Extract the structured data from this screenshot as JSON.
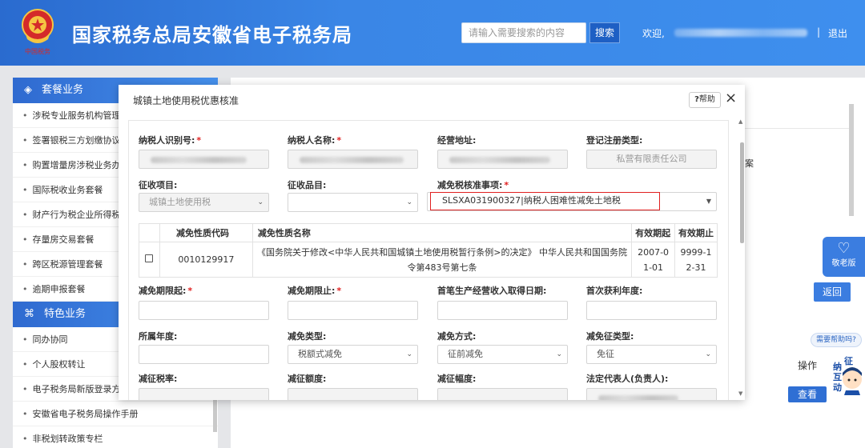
{
  "header": {
    "site_title": "国家税务总局安徽省电子税务局",
    "search_placeholder": "请输入需要搜索的内容",
    "search_button": "搜索",
    "welcome": "欢迎,",
    "separator": "|",
    "logout": "退出"
  },
  "sidebar": {
    "section1_title": "套餐业务",
    "section1_items": [
      "涉税专业服务机构管理",
      "签署银税三方划缴协议",
      "购置增量房涉税业务办",
      "国际税收业务套餐",
      "财产行为税企业所得税",
      "存量房交易套餐",
      "跨区税源管理套餐",
      "逾期申报套餐"
    ],
    "section2_title": "特色业务",
    "section2_items": [
      "同办协同",
      "个人股权转让",
      "电子税务局新版登录方",
      "安徽省电子税务局操作手册",
      "非税划转政策专栏"
    ]
  },
  "modal": {
    "title": "城镇土地使用税优惠核准",
    "help_label": "帮助",
    "close": "×",
    "fields": {
      "taxpayer_id_label": "纳税人识别号:",
      "taxpayer_name_label": "纳税人名称:",
      "address_label": "经营地址:",
      "reg_type_label": "登记注册类型:",
      "reg_type_value": "私营有限责任公司",
      "levy_item_label": "征收项目:",
      "levy_item_value": "城镇土地使用税",
      "levy_product_label": "征收品目:",
      "levy_product_value": "",
      "exempt_item_label": "减免税核准事项:",
      "exempt_item_value": "SLSXA031900327|纳税人困难性减免土地税",
      "period_start_label": "减免期限起:",
      "period_end_label": "减免期限止:",
      "first_income_date_label": "首笔生产经营收入取得日期:",
      "first_profit_year_label": "首次获利年度:",
      "belong_year_label": "所属年度:",
      "exempt_type_label": "减免类型:",
      "exempt_type_value": "税额式减免",
      "exempt_method_label": "减免方式:",
      "exempt_method_value": "征前减免",
      "exempt_levy_type_label": "减免征类型:",
      "exempt_levy_type_value": "免征",
      "levy_rate_label": "减征税率:",
      "levy_amount_label": "减征额度:",
      "levy_range_label": "减征幅度:",
      "legal_rep_label": "法定代表人(负责人):"
    },
    "table": {
      "headers": [
        "",
        "减免性质代码",
        "减免性质名称",
        "有效期起",
        "有效期止"
      ],
      "rows": [
        {
          "code": "0010129917",
          "name": "《国务院关于修改<中华人民共和国城镇土地使用税暂行条例>的决定》 中华人民共和国国务院令第483号第七条",
          "start": "2007-01-01",
          "end": "9999-12-31"
        }
      ]
    }
  },
  "background": {
    "fragment": "案",
    "elder_mode": "敬老版",
    "return_button": "返回",
    "help_bubble": "需要帮助吗?",
    "mascot_text": [
      "纳",
      "征",
      "互",
      "动"
    ],
    "operation_header": "操作",
    "view_button": "查看"
  },
  "colors": {
    "header_blue": "#3a86e6",
    "accent_red": "#e02020",
    "button_blue": "#3b7de0"
  }
}
